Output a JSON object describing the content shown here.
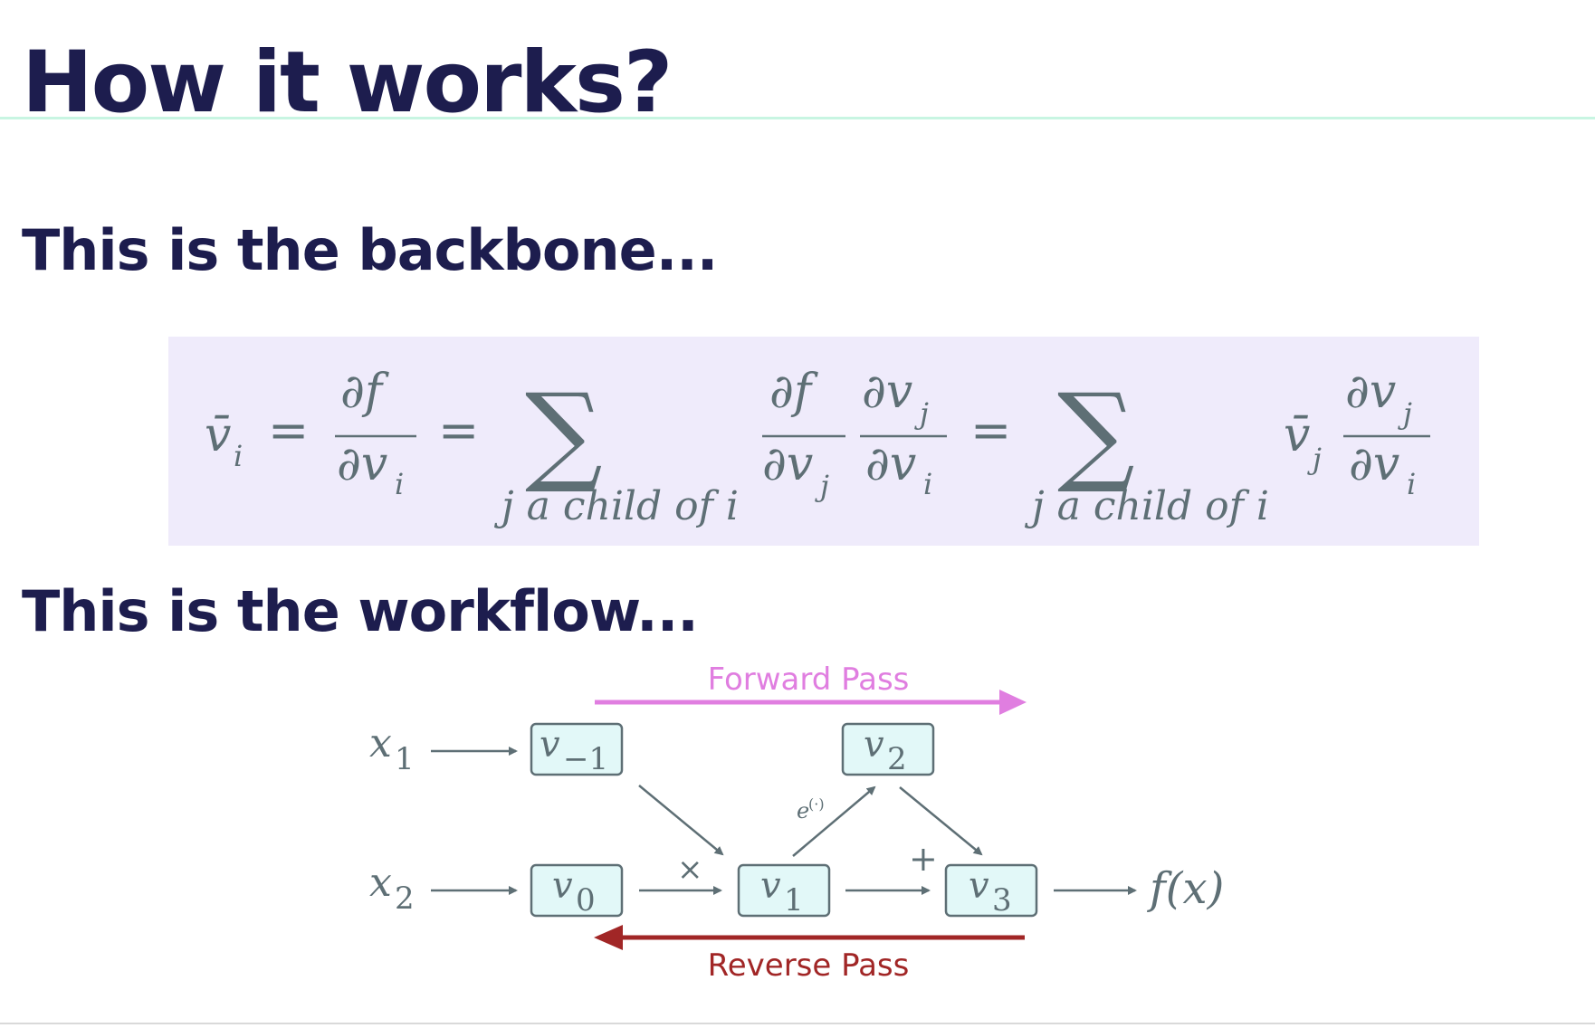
{
  "slide": {
    "title": "How it works?",
    "backbone_heading": "This is the backbone...",
    "workflow_heading": "This is the workflow..."
  },
  "formula": {
    "lhs": "v̄",
    "lhs_sub": "i",
    "df": "∂f",
    "dvi": "∂v",
    "i": "i",
    "j": "j",
    "dvj": "∂v",
    "equals": "=",
    "sigma": "∑",
    "sum_under": "j a child of i",
    "vbar_j": "v̄"
  },
  "diagram": {
    "forward_label": "Forward Pass",
    "reverse_label": "Reverse Pass",
    "forward_color": "#e07ee0",
    "reverse_color": "#a12626",
    "node_fill": "#e2f8f8",
    "node_stroke": "#5e6f75",
    "inputs": {
      "x1": "x",
      "x1_sub": "1",
      "x2": "x",
      "x2_sub": "2"
    },
    "nodes": [
      {
        "id": "v-1",
        "base": "v",
        "sub": "−1"
      },
      {
        "id": "v0",
        "base": "v",
        "sub": "0"
      },
      {
        "id": "v1",
        "base": "v",
        "sub": "1"
      },
      {
        "id": "v2",
        "base": "v",
        "sub": "2"
      },
      {
        "id": "v3",
        "base": "v",
        "sub": "3"
      }
    ],
    "op_multiply": "×",
    "op_add": "+",
    "op_exp": "e",
    "op_exp_sup": "(·)",
    "output": "f(x)"
  }
}
